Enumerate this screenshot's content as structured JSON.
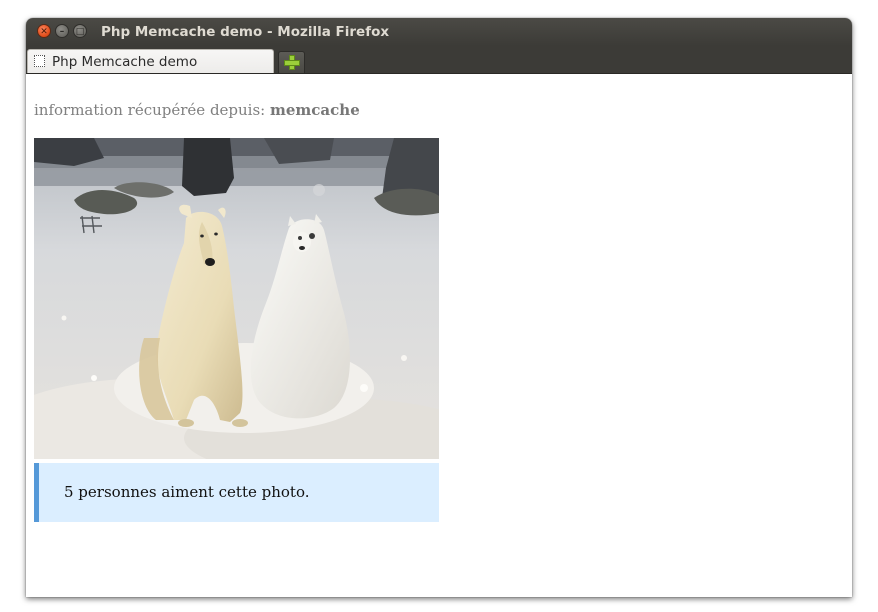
{
  "window": {
    "title": "Php Memcache demo - Mozilla Firefox",
    "controls": {
      "close": "close-icon",
      "minimize": "minimize-icon",
      "maximize": "maximize-icon"
    }
  },
  "tabs": [
    {
      "label": "Php Memcache demo",
      "icon": "blank-page-icon",
      "active": true
    }
  ],
  "new_tab": {
    "icon": "plus-icon"
  },
  "page": {
    "info_prefix": "information récupérée depuis:",
    "info_source": "memcache",
    "image": {
      "subject": "borzoi dog sitting beside a snow dog sculpture in snow"
    },
    "caption": "5 personnes aiment cette photo."
  },
  "colors": {
    "titlebar": "#3c3b37",
    "close_button": "#e24e1b",
    "caption_bg": "#dbeeff",
    "caption_border": "#5599d8",
    "new_tab_plus": "#9bcf3a"
  }
}
